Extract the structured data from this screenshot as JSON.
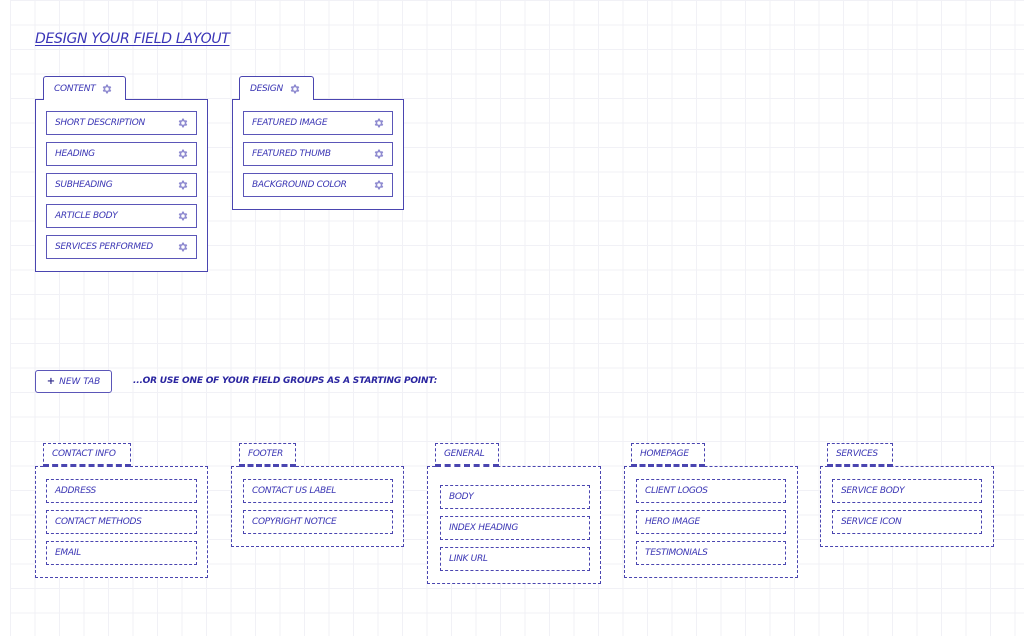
{
  "page": {
    "title": "DESIGN YOUR FIELD LAYOUT"
  },
  "colors": {
    "accent": "#3b36b4",
    "gear": "#8f8bd0",
    "grid": "#f1f1f6"
  },
  "tabs": [
    {
      "label": "CONTENT",
      "icon": "gear-icon",
      "fields": [
        {
          "label": "SHORT DESCRIPTION",
          "icon": "gear-icon"
        },
        {
          "label": "HEADING",
          "icon": "gear-icon"
        },
        {
          "label": "SUBHEADING",
          "icon": "gear-icon"
        },
        {
          "label": "ARTICLE BODY",
          "icon": "gear-icon"
        },
        {
          "label": "SERVICES PERFORMED",
          "icon": "gear-icon"
        }
      ]
    },
    {
      "label": "DESIGN",
      "icon": "gear-icon",
      "fields": [
        {
          "label": "FEATURED IMAGE",
          "icon": "gear-icon"
        },
        {
          "label": "FEATURED THUMB",
          "icon": "gear-icon"
        },
        {
          "label": "BACKGROUND COLOR",
          "icon": "gear-icon"
        }
      ]
    }
  ],
  "actions": {
    "new_tab_icon": "plus-icon",
    "new_tab_label": "NEW TAB",
    "hint": "...OR USE ONE OF YOUR FIELD GROUPS AS A STARTING POINT:"
  },
  "field_groups": [
    {
      "label": "CONTACT INFO",
      "fields": [
        "ADDRESS",
        "CONTACT METHODS",
        "EMAIL"
      ]
    },
    {
      "label": "FOOTER",
      "fields": [
        "CONTACT US LABEL",
        "COPYRIGHT NOTICE"
      ]
    },
    {
      "label": "GENERAL",
      "fields": [
        "BODY",
        "INDEX HEADING",
        "LINK URL"
      ]
    },
    {
      "label": "HOMEPAGE",
      "fields": [
        "CLIENT LOGOS",
        "HERO IMAGE",
        "TESTIMONIALS"
      ]
    },
    {
      "label": "SERVICES",
      "fields": [
        "SERVICE BODY",
        "SERVICE ICON"
      ]
    }
  ]
}
